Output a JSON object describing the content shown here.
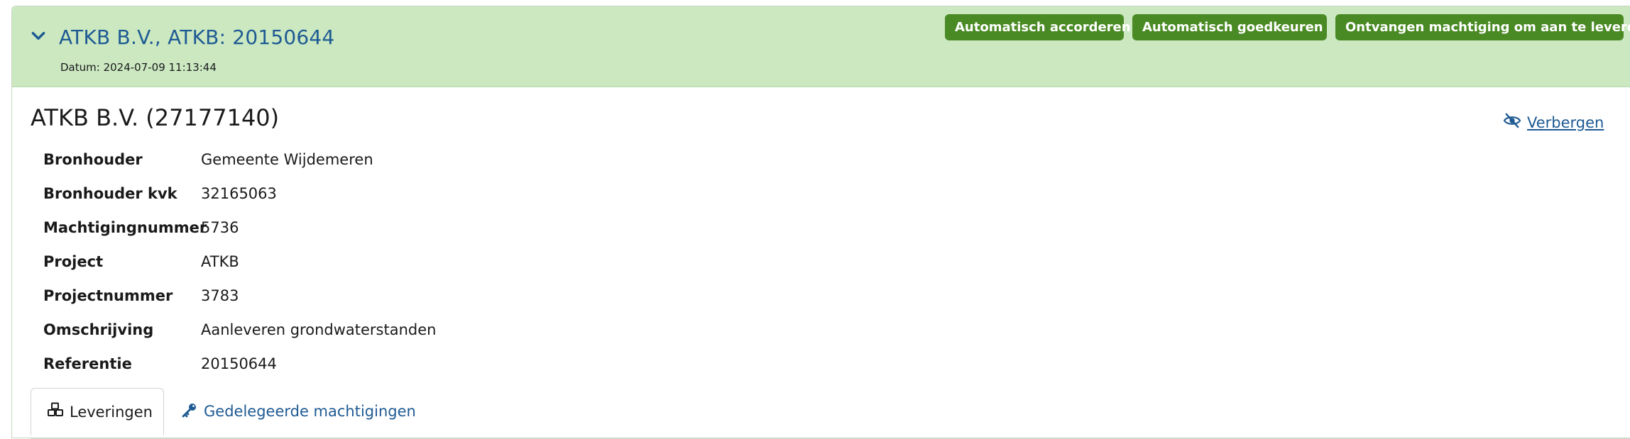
{
  "header": {
    "title": "ATKB B.V., ATKB: 20150644",
    "date": "Datum: 2024-07-09 11:13:44",
    "buttons": {
      "auto_accord": "Automatisch accorderen",
      "auto_approve": "Automatisch goedkeuren",
      "received_authorization": "Ontvangen machtiging om aan te leveren"
    },
    "colors": {
      "header_bg": "#cbe8c1",
      "button_bg": "#4a8a24",
      "link": "#1e5a93"
    }
  },
  "entity": {
    "title": "ATKB B.V. (27177140)",
    "hide_label": "Verbergen"
  },
  "details": [
    {
      "label": "Bronhouder",
      "value": "Gemeente Wijdemeren"
    },
    {
      "label": "Bronhouder kvk",
      "value": "32165063"
    },
    {
      "label": "Machtigingnummer",
      "value": "5736"
    },
    {
      "label": "Project",
      "value": "ATKB"
    },
    {
      "label": "Projectnummer",
      "value": "3783"
    },
    {
      "label": "Omschrijving",
      "value": "Aanleveren grondwaterstanden"
    },
    {
      "label": "Referentie",
      "value": "20150644"
    }
  ],
  "tabs": [
    {
      "label": "Leveringen",
      "icon": "cubes-icon",
      "active": true
    },
    {
      "label": "Gedelegeerde machtigingen",
      "icon": "key-icon",
      "active": false
    }
  ]
}
